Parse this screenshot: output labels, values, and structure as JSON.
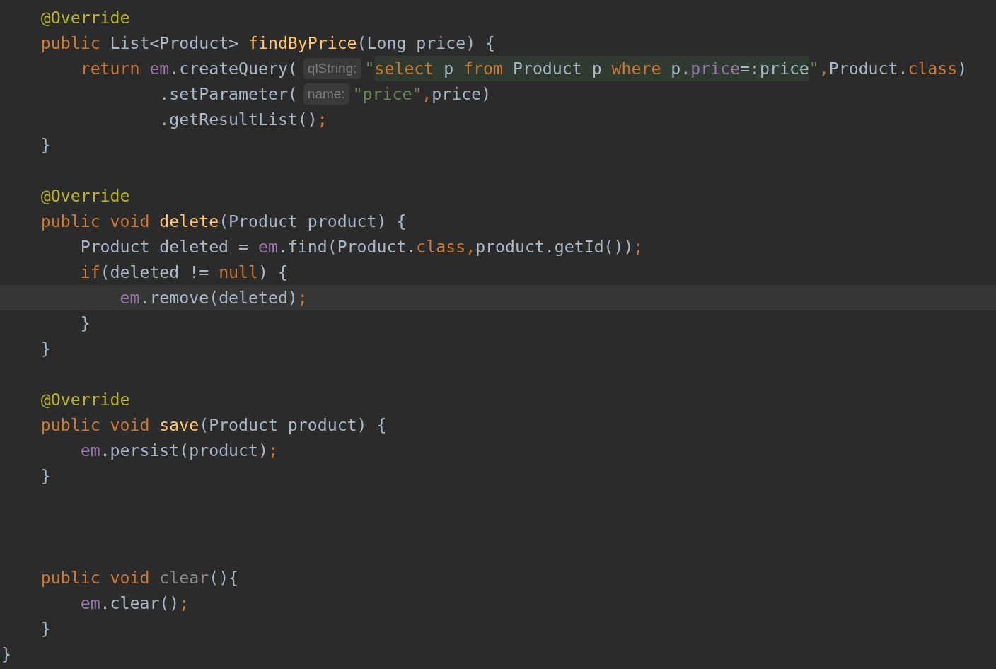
{
  "editor": {
    "lines": [
      {
        "current": false,
        "tokens": [
          {
            "kind": "ann",
            "text": "    @Override"
          }
        ]
      },
      {
        "current": false,
        "tokens": [
          {
            "kind": "kw",
            "text": "    public"
          },
          {
            "kind": "plain",
            "text": " List<Product> "
          },
          {
            "kind": "fn",
            "text": "findByPrice"
          },
          {
            "kind": "plain",
            "text": "(Long price) {"
          }
        ]
      },
      {
        "current": false,
        "tokens": [
          {
            "kind": "kw",
            "text": "        return"
          },
          {
            "kind": "field",
            "text": " em"
          },
          {
            "kind": "plain",
            "text": ".createQuery("
          },
          {
            "kind": "hint",
            "text": "qlString:"
          },
          {
            "kind": "str",
            "text": "\""
          },
          {
            "kind": "sql-kw",
            "text": "select"
          },
          {
            "kind": "sql",
            "text": " p "
          },
          {
            "kind": "sql-kw",
            "text": "from"
          },
          {
            "kind": "sql",
            "text": " Product p "
          },
          {
            "kind": "sql-kw",
            "text": "where"
          },
          {
            "kind": "sql",
            "text": " p."
          },
          {
            "kind": "sql-field",
            "text": "price"
          },
          {
            "kind": "sql",
            "text": "=:price"
          },
          {
            "kind": "str",
            "text": "\""
          },
          {
            "kind": "punct",
            "text": ","
          },
          {
            "kind": "plain",
            "text": "Product."
          },
          {
            "kind": "kw",
            "text": "class"
          },
          {
            "kind": "plain",
            "text": ")"
          }
        ]
      },
      {
        "current": false,
        "tokens": [
          {
            "kind": "plain",
            "text": "                .setParameter("
          },
          {
            "kind": "hint",
            "text": "name:"
          },
          {
            "kind": "str",
            "text": "\"price\""
          },
          {
            "kind": "punct",
            "text": ","
          },
          {
            "kind": "plain",
            "text": "price)"
          }
        ]
      },
      {
        "current": false,
        "tokens": [
          {
            "kind": "plain",
            "text": "                .getResultList()"
          },
          {
            "kind": "punct",
            "text": ";"
          }
        ]
      },
      {
        "current": false,
        "tokens": [
          {
            "kind": "plain",
            "text": "    }"
          }
        ]
      },
      {
        "current": false
      },
      {
        "current": false,
        "tokens": [
          {
            "kind": "ann",
            "text": "    @Override"
          }
        ]
      },
      {
        "current": false,
        "tokens": [
          {
            "kind": "kw",
            "text": "    public void"
          },
          {
            "kind": "fn",
            "text": " delete"
          },
          {
            "kind": "plain",
            "text": "(Product product) {"
          }
        ]
      },
      {
        "current": false,
        "tokens": [
          {
            "kind": "plain",
            "text": "        Product deleted = "
          },
          {
            "kind": "field",
            "text": "em"
          },
          {
            "kind": "plain",
            "text": ".find(Product."
          },
          {
            "kind": "kw",
            "text": "class"
          },
          {
            "kind": "punct",
            "text": ","
          },
          {
            "kind": "plain",
            "text": "product.getId())"
          },
          {
            "kind": "punct",
            "text": ";"
          }
        ]
      },
      {
        "current": false,
        "tokens": [
          {
            "kind": "kw",
            "text": "        if"
          },
          {
            "kind": "plain",
            "text": "(deleted != "
          },
          {
            "kind": "kw",
            "text": "null"
          },
          {
            "kind": "plain",
            "text": ") {"
          }
        ]
      },
      {
        "current": true,
        "tokens": [
          {
            "kind": "field",
            "text": "            em"
          },
          {
            "kind": "plain",
            "text": ".remove(deleted)"
          },
          {
            "kind": "punct",
            "text": ";"
          }
        ]
      },
      {
        "current": false,
        "tokens": [
          {
            "kind": "plain",
            "text": "        }"
          }
        ]
      },
      {
        "current": false,
        "tokens": [
          {
            "kind": "plain",
            "text": "    }"
          }
        ]
      },
      {
        "current": false
      },
      {
        "current": false,
        "tokens": [
          {
            "kind": "ann",
            "text": "    @Override"
          }
        ]
      },
      {
        "current": false,
        "tokens": [
          {
            "kind": "kw",
            "text": "    public void"
          },
          {
            "kind": "fn",
            "text": " save"
          },
          {
            "kind": "plain",
            "text": "(Product product) {"
          }
        ]
      },
      {
        "current": false,
        "tokens": [
          {
            "kind": "field",
            "text": "        em"
          },
          {
            "kind": "plain",
            "text": ".persist(product)"
          },
          {
            "kind": "punct",
            "text": ";"
          }
        ]
      },
      {
        "current": false,
        "tokens": [
          {
            "kind": "plain",
            "text": "    }"
          }
        ]
      },
      {
        "current": false
      },
      {
        "current": false
      },
      {
        "current": false
      },
      {
        "current": false,
        "tokens": [
          {
            "kind": "kw",
            "text": "    public void"
          },
          {
            "kind": "unused",
            "text": " clear"
          },
          {
            "kind": "plain",
            "text": "(){"
          }
        ]
      },
      {
        "current": false,
        "tokens": [
          {
            "kind": "field",
            "text": "        em"
          },
          {
            "kind": "plain",
            "text": ".clear()"
          },
          {
            "kind": "punct",
            "text": ";"
          }
        ]
      },
      {
        "current": false,
        "tokens": [
          {
            "kind": "plain",
            "text": "    }"
          }
        ]
      },
      {
        "current": false,
        "tokens": [
          {
            "kind": "plain",
            "text": "}"
          }
        ]
      }
    ]
  }
}
